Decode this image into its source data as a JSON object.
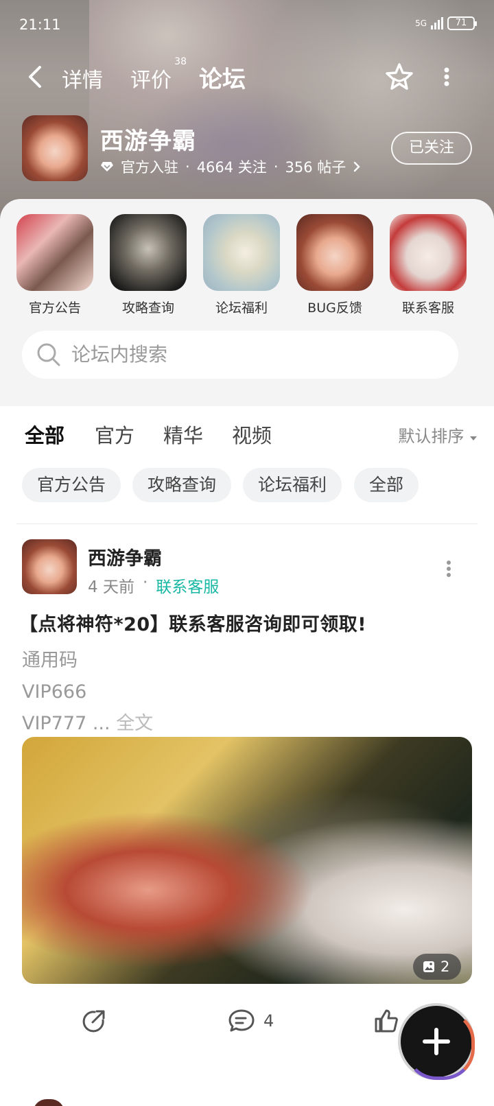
{
  "status": {
    "time": "21:11",
    "network": "5G",
    "battery": "71"
  },
  "nav": {
    "tabs": [
      {
        "label": "详情"
      },
      {
        "label": "评价",
        "badge": "38"
      },
      {
        "label": "论坛"
      }
    ]
  },
  "game": {
    "name": "西游争霸",
    "official": "官方入驻",
    "followers": "4664 关注",
    "posts": "356 帖子",
    "follow_btn": "已关注"
  },
  "shortcuts": [
    {
      "label": "官方公告"
    },
    {
      "label": "攻略查询"
    },
    {
      "label": "论坛福利"
    },
    {
      "label": "BUG反馈"
    },
    {
      "label": "联系客服"
    }
  ],
  "search": {
    "placeholder": "论坛内搜索"
  },
  "filter_tabs": [
    {
      "label": "全部"
    },
    {
      "label": "官方"
    },
    {
      "label": "精华"
    },
    {
      "label": "视频"
    }
  ],
  "sort_label": "默认排序",
  "chips": [
    {
      "label": "官方公告"
    },
    {
      "label": "攻略查询"
    },
    {
      "label": "论坛福利"
    },
    {
      "label": "全部"
    }
  ],
  "post": {
    "author": "西游争霸",
    "time": "4 天前",
    "category": "联系客服",
    "title": "【点将神符*20】联系客服咨询即可领取!",
    "lines": [
      "通用码",
      "VIP666",
      "VIP777 ..."
    ],
    "full_text_label": "全文",
    "image_count": "2",
    "comments": "4"
  },
  "colors": {
    "accent": "#1ccab2",
    "category": "#17b8a3"
  }
}
